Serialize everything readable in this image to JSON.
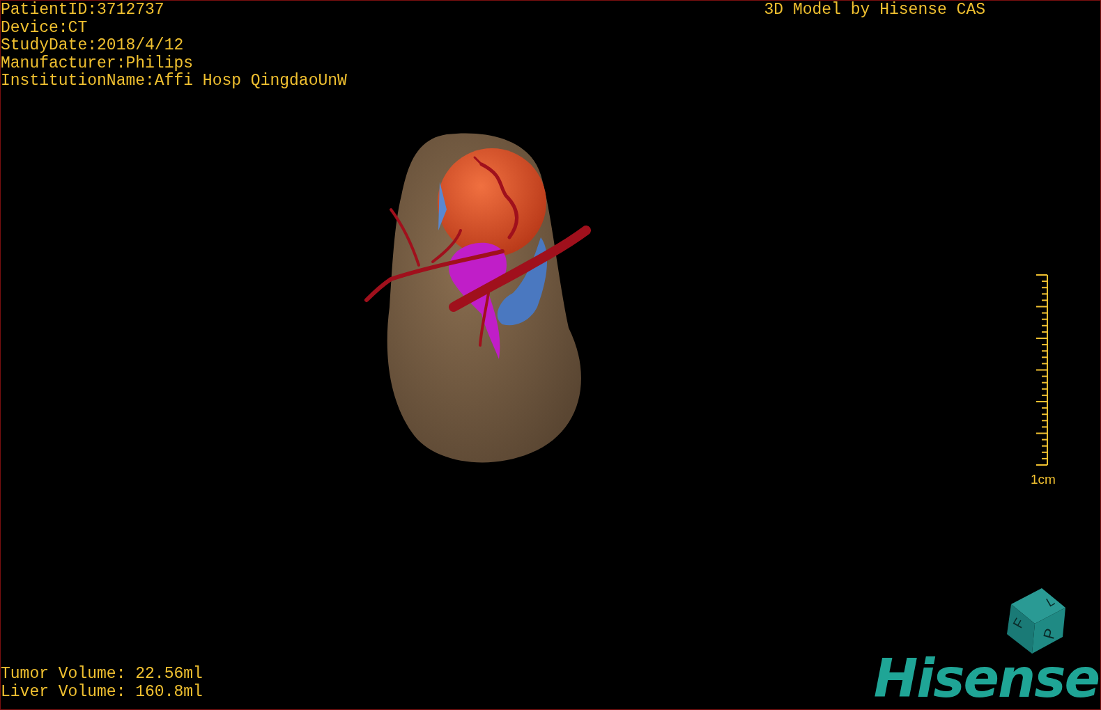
{
  "study_info": [
    "PatientID:3712737",
    "Device:CT",
    "StudyDate:2018/4/12",
    "Manufacturer:Philips",
    "InstitutionName:Affi Hosp QingdaoUnW"
  ],
  "viewer_title": "3D Model by Hisense CAS",
  "scale_bar": {
    "label": "1cm"
  },
  "volumes": [
    "Tumor Volume: 22.56ml",
    "Liver Volume: 160.8ml"
  ],
  "orientation_cube": {
    "labels": [
      "F",
      "L",
      "P"
    ]
  },
  "logo": "Hisense"
}
